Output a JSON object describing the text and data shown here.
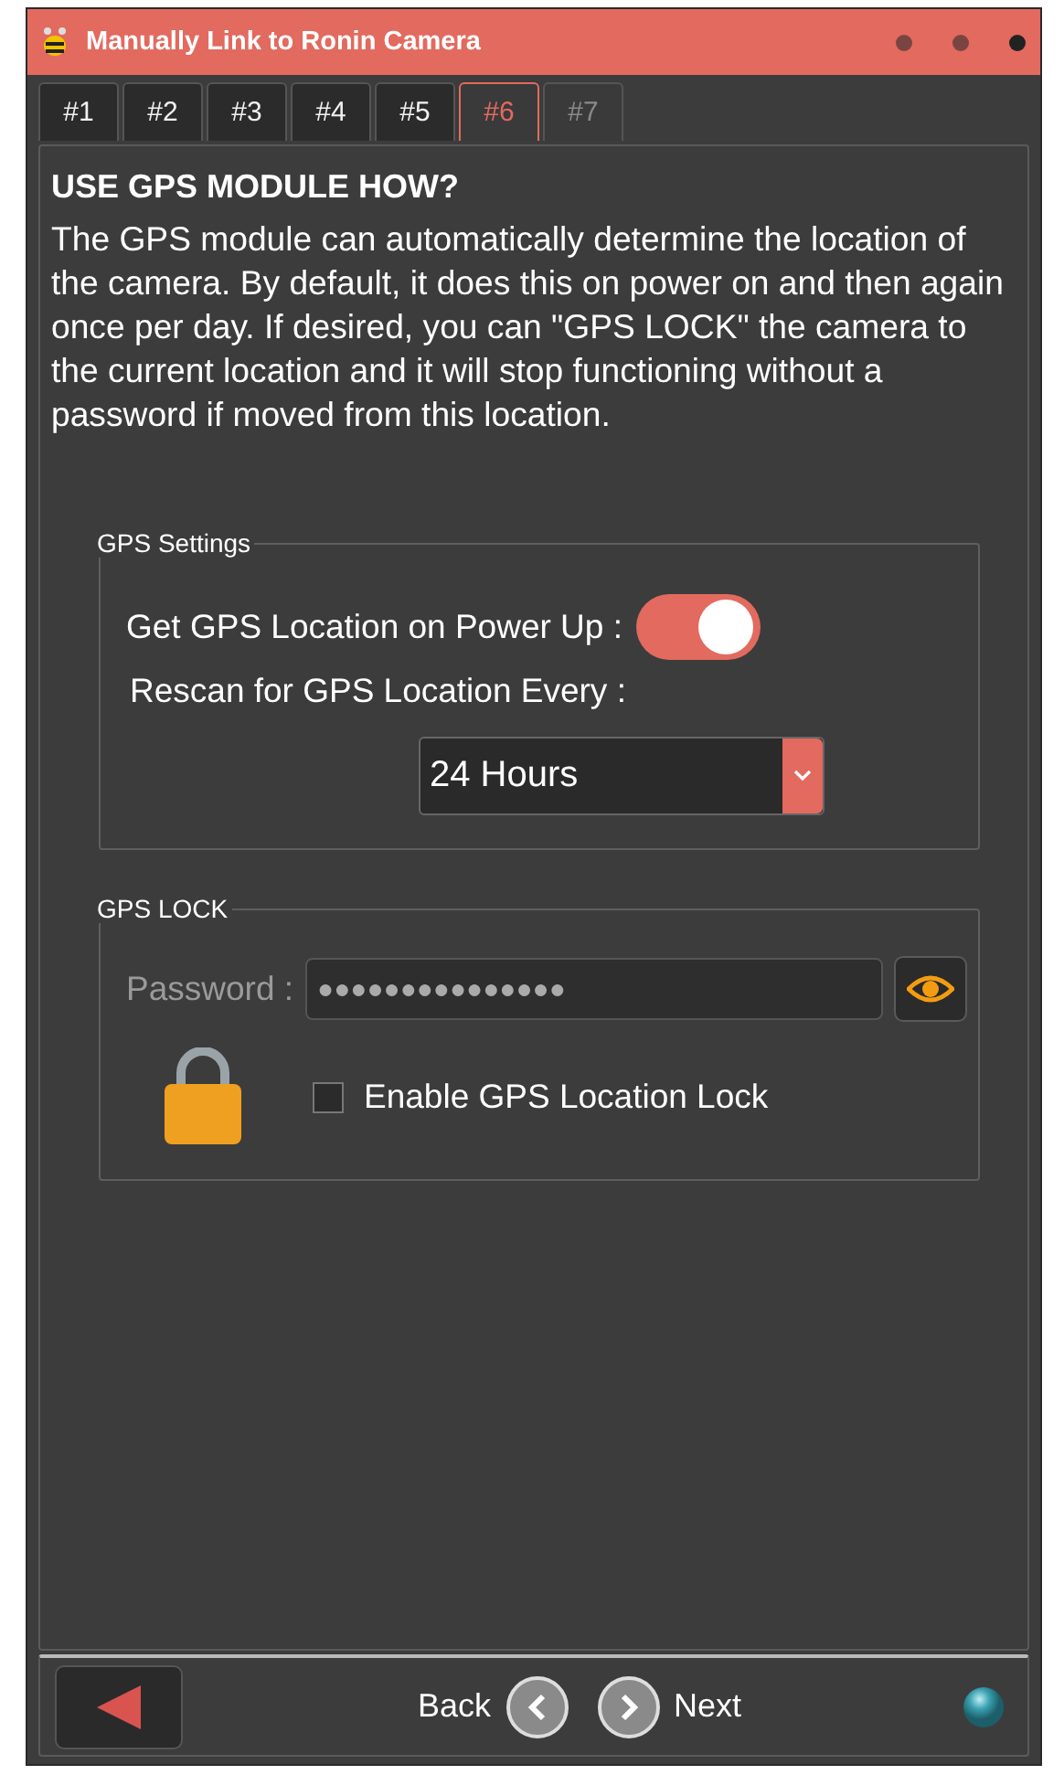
{
  "window": {
    "title": "Manually Link to Ronin Camera"
  },
  "tabs": [
    {
      "label": "#1",
      "selected": false,
      "disabled": false
    },
    {
      "label": "#2",
      "selected": false,
      "disabled": false
    },
    {
      "label": "#3",
      "selected": false,
      "disabled": false
    },
    {
      "label": "#4",
      "selected": false,
      "disabled": false
    },
    {
      "label": "#5",
      "selected": false,
      "disabled": false
    },
    {
      "label": "#6",
      "selected": true,
      "disabled": false
    },
    {
      "label": "#7",
      "selected": false,
      "disabled": true
    }
  ],
  "heading": "USE GPS MODULE HOW?",
  "description": "The GPS module can automatically determine the location of the camera.  By default, it does this on power on and then again once per day.  If desired, you can \"GPS LOCK\" the camera to the current location and it will stop functioning without a password if moved from this location.",
  "gps_settings": {
    "legend": "GPS Settings",
    "power_up_label": "Get GPS Location on Power Up :",
    "power_up_on": true,
    "rescan_label": "Rescan for GPS Location Every :",
    "rescan_value": "24 Hours"
  },
  "gps_lock": {
    "legend": "GPS LOCK",
    "password_label": "Password :",
    "password_disabled": true,
    "password_value": "●●●●●●●●●●●●●●●",
    "lock_label": "Enable GPS Location Lock",
    "lock_checked": false
  },
  "footer": {
    "back": "Back",
    "next": "Next"
  }
}
